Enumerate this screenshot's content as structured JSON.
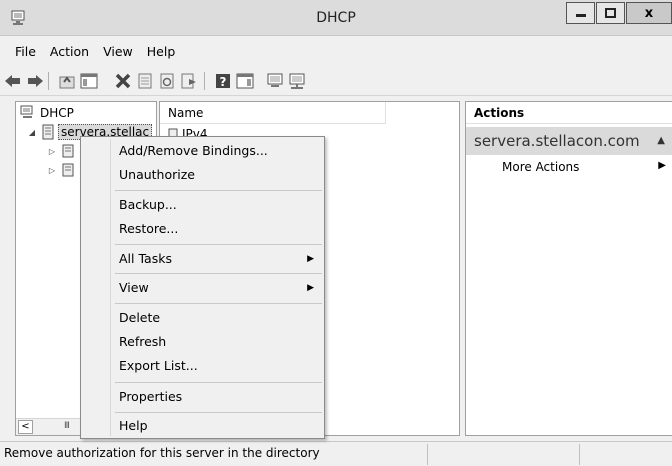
{
  "window": {
    "title": "DHCP",
    "close_glyph": "x"
  },
  "menubar": {
    "items": [
      "File",
      "Action",
      "View",
      "Help"
    ]
  },
  "tree": {
    "root": "DHCP",
    "server": "servera.stellac",
    "children_expand": [
      "▷",
      "▷"
    ],
    "root_expand": "◢"
  },
  "list": {
    "column_name": "Name",
    "row_label": "IPv4"
  },
  "actions": {
    "header": "Actions",
    "section": "servera.stellacon.com",
    "more_actions": "More Actions"
  },
  "context_menu": {
    "items": [
      {
        "label": "Add/Remove Bindings...",
        "submenu": false
      },
      {
        "label": "Unauthorize",
        "submenu": false
      },
      {
        "label": "Backup...",
        "submenu": false
      },
      {
        "label": "Restore...",
        "submenu": false
      },
      {
        "label": "All Tasks",
        "submenu": true
      },
      {
        "label": "View",
        "submenu": true
      },
      {
        "label": "Delete",
        "submenu": false
      },
      {
        "label": "Refresh",
        "submenu": false
      },
      {
        "label": "Export List...",
        "submenu": false
      },
      {
        "label": "Properties",
        "submenu": false
      },
      {
        "label": "Help",
        "submenu": false
      }
    ]
  },
  "scrollbar": {
    "left_arrow": "<",
    "grip": "III"
  },
  "status": {
    "text": "Remove authorization for this server in the directory"
  }
}
